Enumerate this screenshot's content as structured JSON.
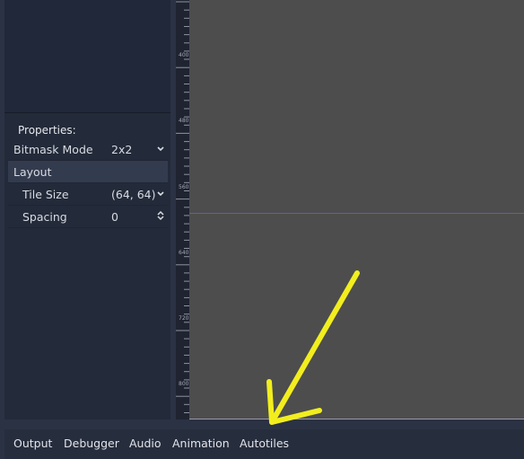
{
  "inspector": {
    "header": "Properties:",
    "bitmask_mode": {
      "label": "Bitmask Mode",
      "value": "2x2"
    },
    "layout_section": "Layout",
    "tile_size": {
      "label": "Tile Size",
      "value": "(64, 64)"
    },
    "spacing": {
      "label": "Spacing",
      "value": "0"
    }
  },
  "ruler": {
    "labels": [
      "400",
      "480",
      "560",
      "640",
      "720",
      "800"
    ]
  },
  "bottom_tabs": [
    "Output",
    "Debugger",
    "Audio",
    "Animation",
    "Autotiles"
  ],
  "colors": {
    "annotation_arrow": "#f2ee1e",
    "canvas": "#4d4d4d",
    "panel": "#232a39"
  }
}
